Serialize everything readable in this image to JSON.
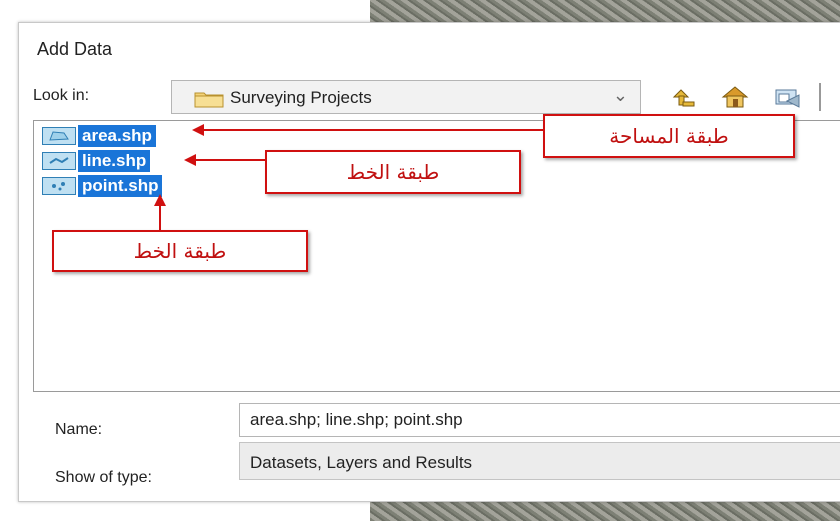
{
  "dialog": {
    "title": "Add Data",
    "look_in_label": "Look in:",
    "look_in_value": "Surveying Projects",
    "name_label": "Name:",
    "name_value": "area.shp; line.shp; point.shp",
    "type_label": "Show of type:",
    "type_value": "Datasets, Layers and Results"
  },
  "toolbar": {
    "icons": [
      "up-one-level-icon",
      "home-icon",
      "connect-folder-icon"
    ]
  },
  "files": [
    {
      "name": "area.shp",
      "icon": "polygon-layer-icon"
    },
    {
      "name": "line.shp",
      "icon": "line-layer-icon"
    },
    {
      "name": "point.shp",
      "icon": "point-layer-icon"
    }
  ],
  "annotations": [
    {
      "text": "طبقة المساحة"
    },
    {
      "text": "طبقة الخط"
    },
    {
      "text": "طبقة الخط"
    }
  ],
  "colors": {
    "selection": "#1a75d8",
    "annotation_border": "#d01010",
    "annotation_text": "#c01010"
  }
}
